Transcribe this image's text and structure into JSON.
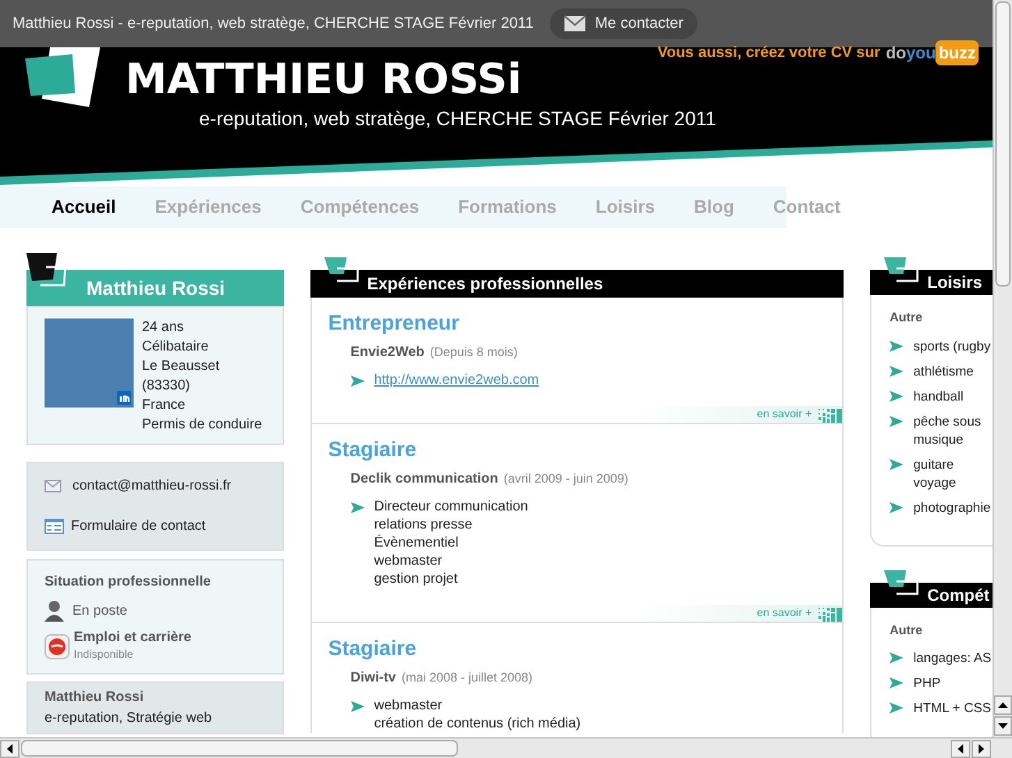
{
  "top_bar": {
    "title": "Matthieu Rossi - e-reputation, web stratège, CHERCHE STAGE Février 2011",
    "contact_button": "Me contacter"
  },
  "header": {
    "promo": "Vous aussi, créez votre CV sur",
    "brand": [
      "do",
      "you",
      "buzz"
    ],
    "name": "MATTHIEU ROSSi",
    "tagline": "e-reputation, web stratège, CHERCHE STAGE Février 2011"
  },
  "nav": [
    {
      "label": "Accueil",
      "selected": true
    },
    {
      "label": "Expériences",
      "selected": false
    },
    {
      "label": "Compétences",
      "selected": false
    },
    {
      "label": "Formations",
      "selected": false
    },
    {
      "label": "Loisirs",
      "selected": false
    },
    {
      "label": "Blog",
      "selected": false
    },
    {
      "label": "Contact",
      "selected": false
    }
  ],
  "profile": {
    "title": "Matthieu Rossi",
    "details": [
      "24 ans",
      "Célibataire",
      "Le Beausset",
      "(83330)",
      "France",
      "Permis de conduire"
    ],
    "email": "contact@matthieu-rossi.fr",
    "contact_form": "Formulaire de contact"
  },
  "situation": {
    "title": "Situation professionnelle",
    "status": "En poste",
    "job_label": "Emploi et carrière",
    "job_status": "Indisponible"
  },
  "summary": {
    "title": "Matthieu Rossi",
    "text": "e-reputation, Stratégie web"
  },
  "experiences": {
    "title": "Expériences professionnelles",
    "items": [
      {
        "role": "Entrepreneur",
        "company": "Envie2Web",
        "period": "(Depuis 8 mois)",
        "bullets": [
          {
            "kind": "link",
            "lines": [
              "http://www.envie2web.com"
            ]
          }
        ],
        "more": "en savoir +"
      },
      {
        "role": "Stagiaire",
        "company": "Declik communication",
        "period": "(avril 2009 - juin 2009)",
        "bullets": [
          {
            "kind": "text",
            "lines": [
              "Directeur communication",
              "relations presse",
              "Évènementiel",
              "webmaster",
              "gestion projet"
            ]
          }
        ],
        "more": "en savoir +"
      },
      {
        "role": "Stagiaire",
        "company": "Diwi-tv",
        "period": "(mai 2008 - juillet 2008)",
        "bullets": [
          {
            "kind": "text",
            "lines": [
              "webmaster",
              "création de contenus (rich média)"
            ]
          }
        ]
      }
    ]
  },
  "side_sections": [
    {
      "title": "Loisirs",
      "group": "Autre",
      "bullets": [
        {
          "lines": [
            "sports (rugby"
          ]
        },
        {
          "lines": [
            "athlétisme"
          ]
        },
        {
          "lines": [
            "handball"
          ]
        },
        {
          "lines": [
            "pêche sous",
            "musique"
          ]
        },
        {
          "lines": [
            "guitare",
            "voyage"
          ]
        },
        {
          "lines": [
            "photographie"
          ]
        }
      ]
    },
    {
      "title": "Compét",
      "group": "Autre",
      "bullets": [
        {
          "lines": [
            "langages: AS"
          ]
        },
        {
          "lines": [
            "PHP"
          ]
        },
        {
          "lines": [
            "HTML + CSS"
          ]
        }
      ]
    }
  ]
}
